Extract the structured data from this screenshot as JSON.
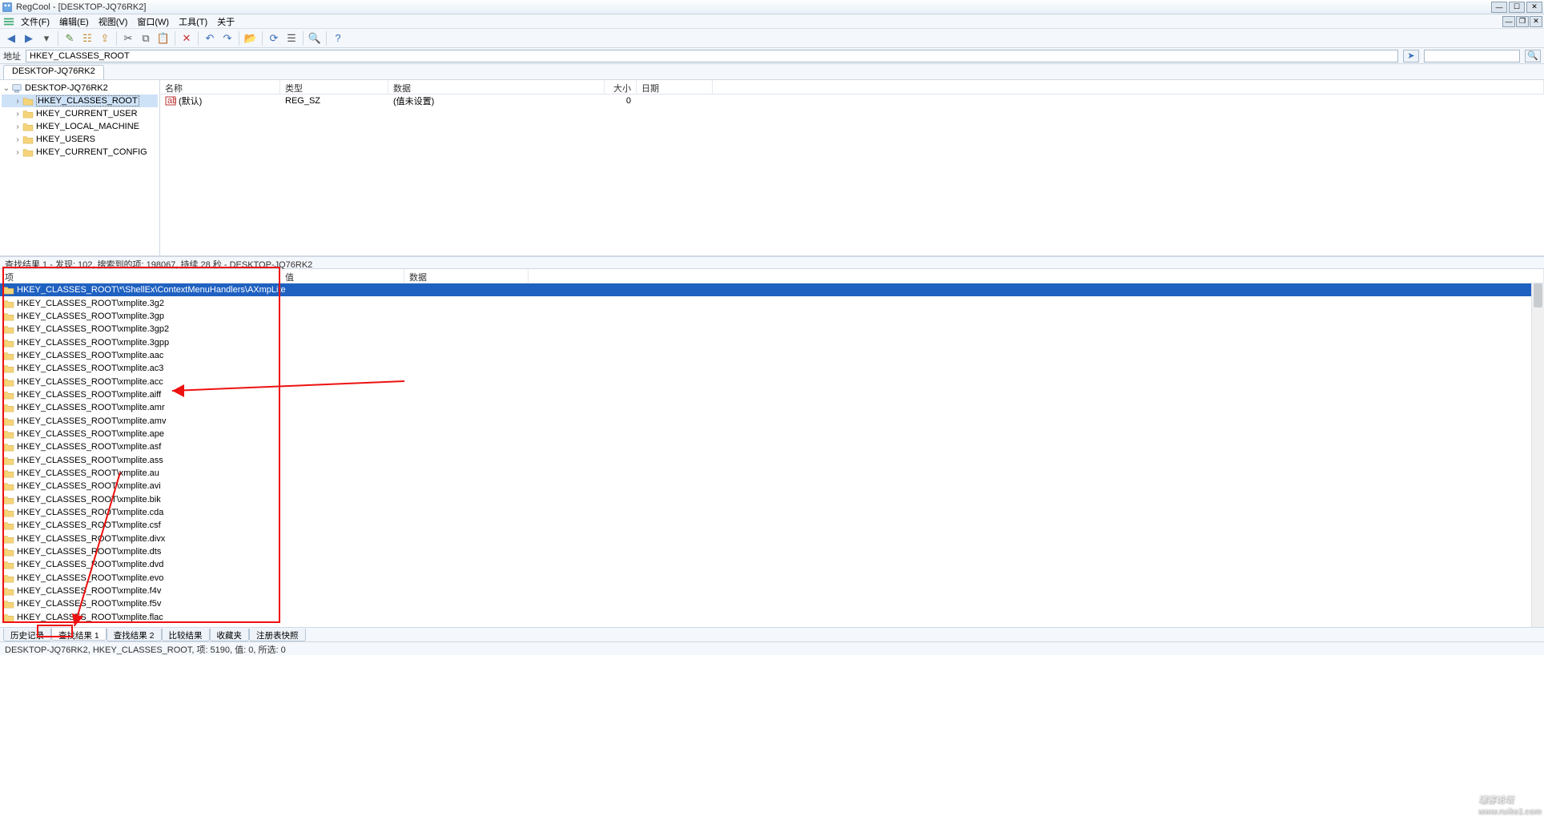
{
  "title": "RegCool - [DESKTOP-JQ76RK2]",
  "menus": [
    "文件(F)",
    "编辑(E)",
    "视图(V)",
    "窗口(W)",
    "工具(T)",
    "关于"
  ],
  "address_label": "地址",
  "address_value": "HKEY_CLASSES_ROOT",
  "doc_tab": "DESKTOP-JQ76RK2",
  "tree": {
    "root": "DESKTOP-JQ76RK2",
    "children": [
      "HKEY_CLASSES_ROOT",
      "HKEY_CURRENT_USER",
      "HKEY_LOCAL_MACHINE",
      "HKEY_USERS",
      "HKEY_CURRENT_CONFIG"
    ],
    "selected_index": 0
  },
  "value_columns": {
    "name": "名称",
    "type": "类型",
    "data": "数据",
    "size": "大小",
    "date": "日期"
  },
  "value_row": {
    "name": "(默认)",
    "type": "REG_SZ",
    "data": "(值未设置)",
    "size": "0",
    "date": ""
  },
  "search_status": "查找结果 1 - 发现: 102, 搜索到的项: 198067, 持续 28 秒 - DESKTOP-JQ76RK2",
  "result_columns": {
    "item": "项",
    "value": "值",
    "data": "数据"
  },
  "results": [
    "HKEY_CLASSES_ROOT\\*\\ShellEx\\ContextMenuHandlers\\AXmpLite",
    "HKEY_CLASSES_ROOT\\xmplite.3g2",
    "HKEY_CLASSES_ROOT\\xmplite.3gp",
    "HKEY_CLASSES_ROOT\\xmplite.3gp2",
    "HKEY_CLASSES_ROOT\\xmplite.3gpp",
    "HKEY_CLASSES_ROOT\\xmplite.aac",
    "HKEY_CLASSES_ROOT\\xmplite.ac3",
    "HKEY_CLASSES_ROOT\\xmplite.acc",
    "HKEY_CLASSES_ROOT\\xmplite.aiff",
    "HKEY_CLASSES_ROOT\\xmplite.amr",
    "HKEY_CLASSES_ROOT\\xmplite.amv",
    "HKEY_CLASSES_ROOT\\xmplite.ape",
    "HKEY_CLASSES_ROOT\\xmplite.asf",
    "HKEY_CLASSES_ROOT\\xmplite.ass",
    "HKEY_CLASSES_ROOT\\xmplite.au",
    "HKEY_CLASSES_ROOT\\xmplite.avi",
    "HKEY_CLASSES_ROOT\\xmplite.bik",
    "HKEY_CLASSES_ROOT\\xmplite.cda",
    "HKEY_CLASSES_ROOT\\xmplite.csf",
    "HKEY_CLASSES_ROOT\\xmplite.divx",
    "HKEY_CLASSES_ROOT\\xmplite.dts",
    "HKEY_CLASSES_ROOT\\xmplite.dvd",
    "HKEY_CLASSES_ROOT\\xmplite.evo",
    "HKEY_CLASSES_ROOT\\xmplite.f4v",
    "HKEY_CLASSES_ROOT\\xmplite.f5v",
    "HKEY_CLASSES_ROOT\\xmplite.flac"
  ],
  "results_selected_index": 0,
  "bottom_tabs": [
    "历史记录",
    "查找结果 1",
    "查找结果 2",
    "比较结果",
    "收藏夹",
    "注册表快照"
  ],
  "bottom_tab_active": 1,
  "statusbar": "DESKTOP-JQ76RK2, HKEY_CLASSES_ROOT, 项: 5190, 值: 0, 所选: 0",
  "watermark": {
    "main": "瑞客论坛",
    "sub": "www.ruike1.com"
  },
  "toolbar_icons": [
    {
      "name": "back-icon",
      "glyph": "◀",
      "color": "#3a6fb7"
    },
    {
      "name": "forward-icon",
      "glyph": "▶",
      "color": "#3a6fb7"
    },
    {
      "name": "dropdown-icon",
      "glyph": "▾",
      "color": "#555"
    },
    {
      "name": "sep"
    },
    {
      "name": "new-key-icon",
      "glyph": "✎",
      "color": "#5a8f3d"
    },
    {
      "name": "new-value-icon",
      "glyph": "☷",
      "color": "#c98b2e"
    },
    {
      "name": "export-icon",
      "glyph": "⇪",
      "color": "#c98b2e"
    },
    {
      "name": "sep"
    },
    {
      "name": "cut-icon",
      "glyph": "✂",
      "color": "#555"
    },
    {
      "name": "copy-icon",
      "glyph": "⧉",
      "color": "#555"
    },
    {
      "name": "paste-icon",
      "glyph": "📋",
      "color": "#555"
    },
    {
      "name": "sep"
    },
    {
      "name": "delete-icon",
      "glyph": "✕",
      "color": "#c33"
    },
    {
      "name": "sep"
    },
    {
      "name": "undo-icon",
      "glyph": "↶",
      "color": "#3a6fb7"
    },
    {
      "name": "redo-icon",
      "glyph": "↷",
      "color": "#3a6fb7"
    },
    {
      "name": "sep"
    },
    {
      "name": "open-icon",
      "glyph": "📂",
      "color": "#c98b2e"
    },
    {
      "name": "sep"
    },
    {
      "name": "refresh-icon",
      "glyph": "⟳",
      "color": "#3a6fb7"
    },
    {
      "name": "properties-icon",
      "glyph": "☰",
      "color": "#555"
    },
    {
      "name": "sep"
    },
    {
      "name": "find-icon",
      "glyph": "🔍",
      "color": "#3a6fb7"
    },
    {
      "name": "sep"
    },
    {
      "name": "help-icon",
      "glyph": "?",
      "color": "#3a6fb7"
    }
  ]
}
